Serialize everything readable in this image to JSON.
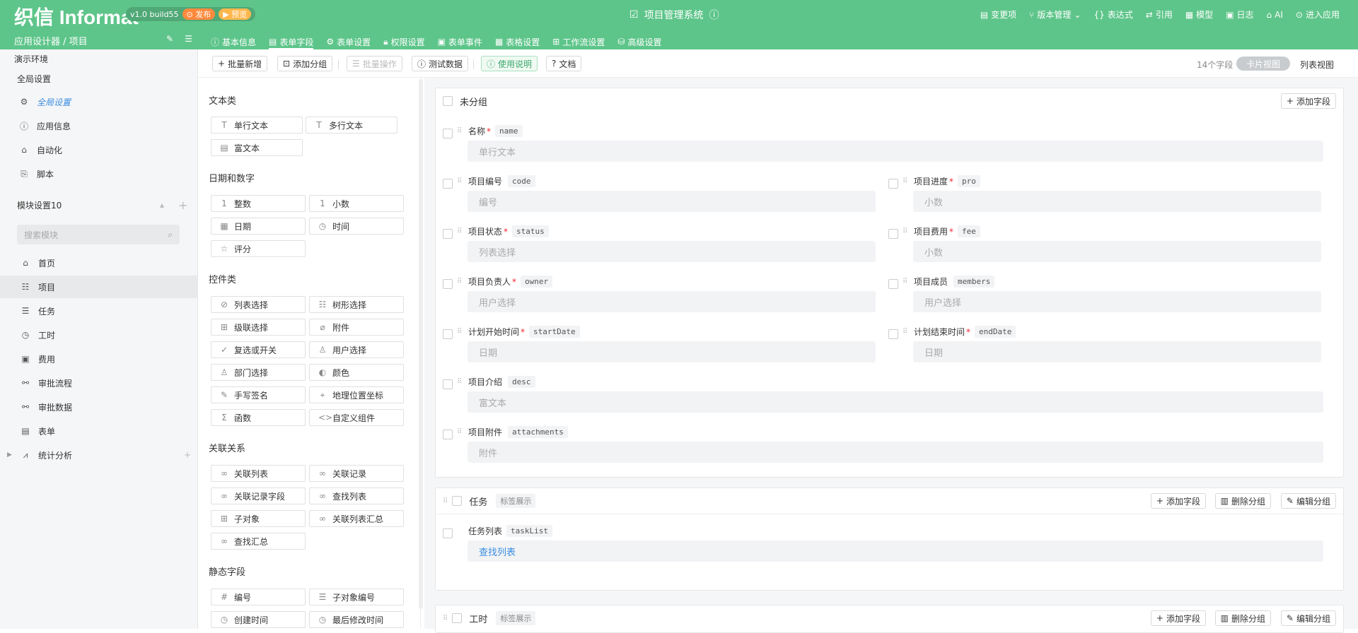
{
  "topbar": {
    "logo": "织信 Informat",
    "version": "v1.0 build55",
    "publish": "发布",
    "preview": "预览",
    "title": "项目管理系统",
    "right": [
      "变更项",
      "版本管理",
      "表达式",
      "引用",
      "模型",
      "日志",
      "AI",
      "进入应用"
    ]
  },
  "subbar": {
    "breadcrumb": "应用设计器 / 项目",
    "tabs": [
      "基本信息",
      "表单字段",
      "表单设置",
      "权限设置",
      "表单事件",
      "表格设置",
      "工作流设置",
      "高级设置"
    ]
  },
  "sidebar": {
    "env": "演示环境",
    "global": "全局设置",
    "items_top": [
      "全局设置",
      "应用信息",
      "自动化",
      "脚本"
    ],
    "module_header": "模块设置10",
    "search_placeholder": "搜索模块",
    "modules": [
      "首页",
      "项目",
      "任务",
      "工时",
      "费用",
      "审批流程",
      "审批数据",
      "表单",
      "统计分析"
    ]
  },
  "toolbar": {
    "batch_add": "批量新增",
    "add_group": "添加分组",
    "batch_op": "批量操作",
    "test_data": "测试数据",
    "usage": "使用说明",
    "docs": "文档",
    "field_count": "14个字段",
    "card_view": "卡片视图",
    "list_view": "列表视图"
  },
  "palette": {
    "sections": [
      {
        "title": "文本类",
        "items": [
          "单行文本",
          "多行文本",
          "富文本"
        ]
      },
      {
        "title": "日期和数字",
        "items": [
          "整数",
          "小数",
          "日期",
          "时间",
          "评分"
        ]
      },
      {
        "title": "控件类",
        "items": [
          "列表选择",
          "树形选择",
          "级联选择",
          "附件",
          "复选或开关",
          "用户选择",
          "部门选择",
          "颜色",
          "手写签名",
          "地理位置坐标",
          "函数",
          "自定义组件"
        ]
      },
      {
        "title": "关联关系",
        "items": [
          "关联列表",
          "关联记录",
          "关联记录字段",
          "查找列表",
          "子对象",
          "关联列表汇总",
          "查找汇总"
        ]
      },
      {
        "title": "静态字段",
        "items": [
          "编号",
          "子对象编号",
          "创建时间",
          "最后修改时间"
        ]
      }
    ]
  },
  "groups": {
    "ungrouped": {
      "title": "未分组",
      "add_field": "添加字段",
      "fields": [
        {
          "label": "名称",
          "required": "*",
          "code": "name",
          "placeholder": "单行文本"
        },
        {
          "label": "项目编号",
          "required": "",
          "code": "code",
          "placeholder": "编号"
        },
        {
          "label": "项目进度",
          "required": "*",
          "code": "pro",
          "placeholder": "小数"
        },
        {
          "label": "项目状态",
          "required": "*",
          "code": "status",
          "placeholder": "列表选择"
        },
        {
          "label": "项目费用",
          "required": "*",
          "code": "fee",
          "placeholder": "小数"
        },
        {
          "label": "项目负责人",
          "required": "*",
          "code": "owner",
          "placeholder": "用户选择"
        },
        {
          "label": "项目成员",
          "required": "",
          "code": "members",
          "placeholder": "用户选择"
        },
        {
          "label": "计划开始时间",
          "required": "*",
          "code": "startDate",
          "placeholder": "日期"
        },
        {
          "label": "计划结束时间",
          "required": "*",
          "code": "endDate",
          "placeholder": "日期"
        },
        {
          "label": "项目介绍",
          "required": "",
          "code": "desc",
          "placeholder": "富文本"
        },
        {
          "label": "项目附件",
          "required": "",
          "code": "attachments",
          "placeholder": "附件"
        }
      ]
    },
    "task": {
      "title": "任务",
      "tag": "标签展示",
      "add_field": "添加字段",
      "delete_group": "删除分组",
      "edit_group": "编辑分组",
      "field": {
        "label": "任务列表",
        "code": "taskList",
        "placeholder": "查找列表"
      }
    },
    "worktime": {
      "title": "工时",
      "tag": "标签展示",
      "add_field": "添加字段",
      "delete_group": "删除分组",
      "edit_group": "编辑分组"
    }
  }
}
